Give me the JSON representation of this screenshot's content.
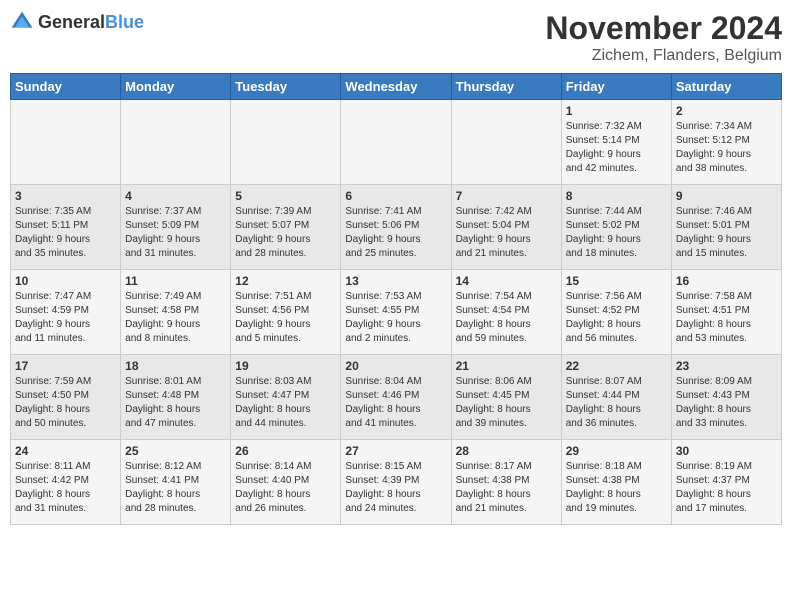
{
  "header": {
    "logo_general": "General",
    "logo_blue": "Blue",
    "title": "November 2024",
    "subtitle": "Zichem, Flanders, Belgium"
  },
  "weekdays": [
    "Sunday",
    "Monday",
    "Tuesday",
    "Wednesday",
    "Thursday",
    "Friday",
    "Saturday"
  ],
  "weeks": [
    [
      {
        "day": "",
        "info": ""
      },
      {
        "day": "",
        "info": ""
      },
      {
        "day": "",
        "info": ""
      },
      {
        "day": "",
        "info": ""
      },
      {
        "day": "",
        "info": ""
      },
      {
        "day": "1",
        "info": "Sunrise: 7:32 AM\nSunset: 5:14 PM\nDaylight: 9 hours\nand 42 minutes."
      },
      {
        "day": "2",
        "info": "Sunrise: 7:34 AM\nSunset: 5:12 PM\nDaylight: 9 hours\nand 38 minutes."
      }
    ],
    [
      {
        "day": "3",
        "info": "Sunrise: 7:35 AM\nSunset: 5:11 PM\nDaylight: 9 hours\nand 35 minutes."
      },
      {
        "day": "4",
        "info": "Sunrise: 7:37 AM\nSunset: 5:09 PM\nDaylight: 9 hours\nand 31 minutes."
      },
      {
        "day": "5",
        "info": "Sunrise: 7:39 AM\nSunset: 5:07 PM\nDaylight: 9 hours\nand 28 minutes."
      },
      {
        "day": "6",
        "info": "Sunrise: 7:41 AM\nSunset: 5:06 PM\nDaylight: 9 hours\nand 25 minutes."
      },
      {
        "day": "7",
        "info": "Sunrise: 7:42 AM\nSunset: 5:04 PM\nDaylight: 9 hours\nand 21 minutes."
      },
      {
        "day": "8",
        "info": "Sunrise: 7:44 AM\nSunset: 5:02 PM\nDaylight: 9 hours\nand 18 minutes."
      },
      {
        "day": "9",
        "info": "Sunrise: 7:46 AM\nSunset: 5:01 PM\nDaylight: 9 hours\nand 15 minutes."
      }
    ],
    [
      {
        "day": "10",
        "info": "Sunrise: 7:47 AM\nSunset: 4:59 PM\nDaylight: 9 hours\nand 11 minutes."
      },
      {
        "day": "11",
        "info": "Sunrise: 7:49 AM\nSunset: 4:58 PM\nDaylight: 9 hours\nand 8 minutes."
      },
      {
        "day": "12",
        "info": "Sunrise: 7:51 AM\nSunset: 4:56 PM\nDaylight: 9 hours\nand 5 minutes."
      },
      {
        "day": "13",
        "info": "Sunrise: 7:53 AM\nSunset: 4:55 PM\nDaylight: 9 hours\nand 2 minutes."
      },
      {
        "day": "14",
        "info": "Sunrise: 7:54 AM\nSunset: 4:54 PM\nDaylight: 8 hours\nand 59 minutes."
      },
      {
        "day": "15",
        "info": "Sunrise: 7:56 AM\nSunset: 4:52 PM\nDaylight: 8 hours\nand 56 minutes."
      },
      {
        "day": "16",
        "info": "Sunrise: 7:58 AM\nSunset: 4:51 PM\nDaylight: 8 hours\nand 53 minutes."
      }
    ],
    [
      {
        "day": "17",
        "info": "Sunrise: 7:59 AM\nSunset: 4:50 PM\nDaylight: 8 hours\nand 50 minutes."
      },
      {
        "day": "18",
        "info": "Sunrise: 8:01 AM\nSunset: 4:48 PM\nDaylight: 8 hours\nand 47 minutes."
      },
      {
        "day": "19",
        "info": "Sunrise: 8:03 AM\nSunset: 4:47 PM\nDaylight: 8 hours\nand 44 minutes."
      },
      {
        "day": "20",
        "info": "Sunrise: 8:04 AM\nSunset: 4:46 PM\nDaylight: 8 hours\nand 41 minutes."
      },
      {
        "day": "21",
        "info": "Sunrise: 8:06 AM\nSunset: 4:45 PM\nDaylight: 8 hours\nand 39 minutes."
      },
      {
        "day": "22",
        "info": "Sunrise: 8:07 AM\nSunset: 4:44 PM\nDaylight: 8 hours\nand 36 minutes."
      },
      {
        "day": "23",
        "info": "Sunrise: 8:09 AM\nSunset: 4:43 PM\nDaylight: 8 hours\nand 33 minutes."
      }
    ],
    [
      {
        "day": "24",
        "info": "Sunrise: 8:11 AM\nSunset: 4:42 PM\nDaylight: 8 hours\nand 31 minutes."
      },
      {
        "day": "25",
        "info": "Sunrise: 8:12 AM\nSunset: 4:41 PM\nDaylight: 8 hours\nand 28 minutes."
      },
      {
        "day": "26",
        "info": "Sunrise: 8:14 AM\nSunset: 4:40 PM\nDaylight: 8 hours\nand 26 minutes."
      },
      {
        "day": "27",
        "info": "Sunrise: 8:15 AM\nSunset: 4:39 PM\nDaylight: 8 hours\nand 24 minutes."
      },
      {
        "day": "28",
        "info": "Sunrise: 8:17 AM\nSunset: 4:38 PM\nDaylight: 8 hours\nand 21 minutes."
      },
      {
        "day": "29",
        "info": "Sunrise: 8:18 AM\nSunset: 4:38 PM\nDaylight: 8 hours\nand 19 minutes."
      },
      {
        "day": "30",
        "info": "Sunrise: 8:19 AM\nSunset: 4:37 PM\nDaylight: 8 hours\nand 17 minutes."
      }
    ]
  ]
}
